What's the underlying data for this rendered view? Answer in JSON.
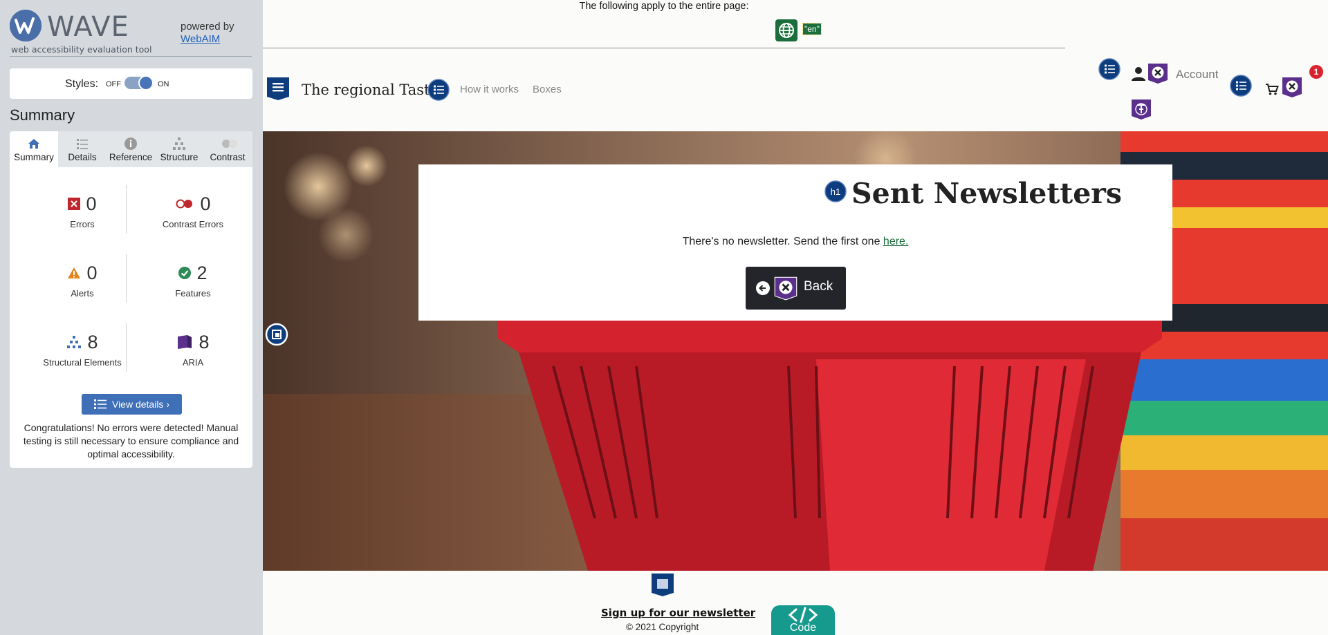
{
  "wave": {
    "logo_text": "WAVE",
    "tagline": "web accessibility evaluation tool",
    "powered_by": "powered by",
    "webaim_link": "WebAIM",
    "styles_label": "Styles:",
    "styles_off": "OFF",
    "styles_on": "ON",
    "summary_heading": "Summary",
    "tabs": [
      {
        "label": "Summary",
        "icon": "home-icon"
      },
      {
        "label": "Details",
        "icon": "list-icon"
      },
      {
        "label": "Reference",
        "icon": "info-icon"
      },
      {
        "label": "Structure",
        "icon": "structure-icon"
      },
      {
        "label": "Contrast",
        "icon": "contrast-icon"
      }
    ],
    "stats": [
      {
        "count": "0",
        "label": "Errors",
        "icon": "error-icon",
        "color": "#c0262d"
      },
      {
        "count": "0",
        "label": "Contrast Errors",
        "icon": "contrast-error-icon",
        "color": "#c0262d"
      },
      {
        "count": "0",
        "label": "Alerts",
        "icon": "alert-icon",
        "color": "#e9831a"
      },
      {
        "count": "2",
        "label": "Features",
        "icon": "feature-icon",
        "color": "#2e8b57"
      },
      {
        "count": "8",
        "label": "Structural Elements",
        "icon": "structure-icon",
        "color": "#3f6fb7"
      },
      {
        "count": "8",
        "label": "ARIA",
        "icon": "aria-icon",
        "color": "#5b2f8c"
      }
    ],
    "view_details": "View details ›",
    "congrats": "Congratulations! No errors were detected! Manual testing is still necessary to ensure compliance and optimal accessibility."
  },
  "page": {
    "applies_text": "The following apply to the entire page:",
    "lang_tag": "\"en\"",
    "brand": "The regional Taste",
    "nav": [
      "How it works",
      "Boxes"
    ],
    "account": "Account",
    "cart_badge": "1",
    "title_tag": "h1",
    "title": "Sent Newsletters",
    "message": "There's no newsletter. Send the first one ",
    "message_link": "here.",
    "back": "Back",
    "signup": "Sign up for our newsletter",
    "copyright": "© 2021 Copyright",
    "code_label": "Code"
  },
  "colors": {
    "wave_sidebar": "#d5d9de",
    "wave_blue": "#3f6fb7",
    "aria_purple": "#5b2f8c",
    "feature_green": "#1b6e3c",
    "structure_navy": "#0d3d7d",
    "code_teal": "#179a8e"
  }
}
